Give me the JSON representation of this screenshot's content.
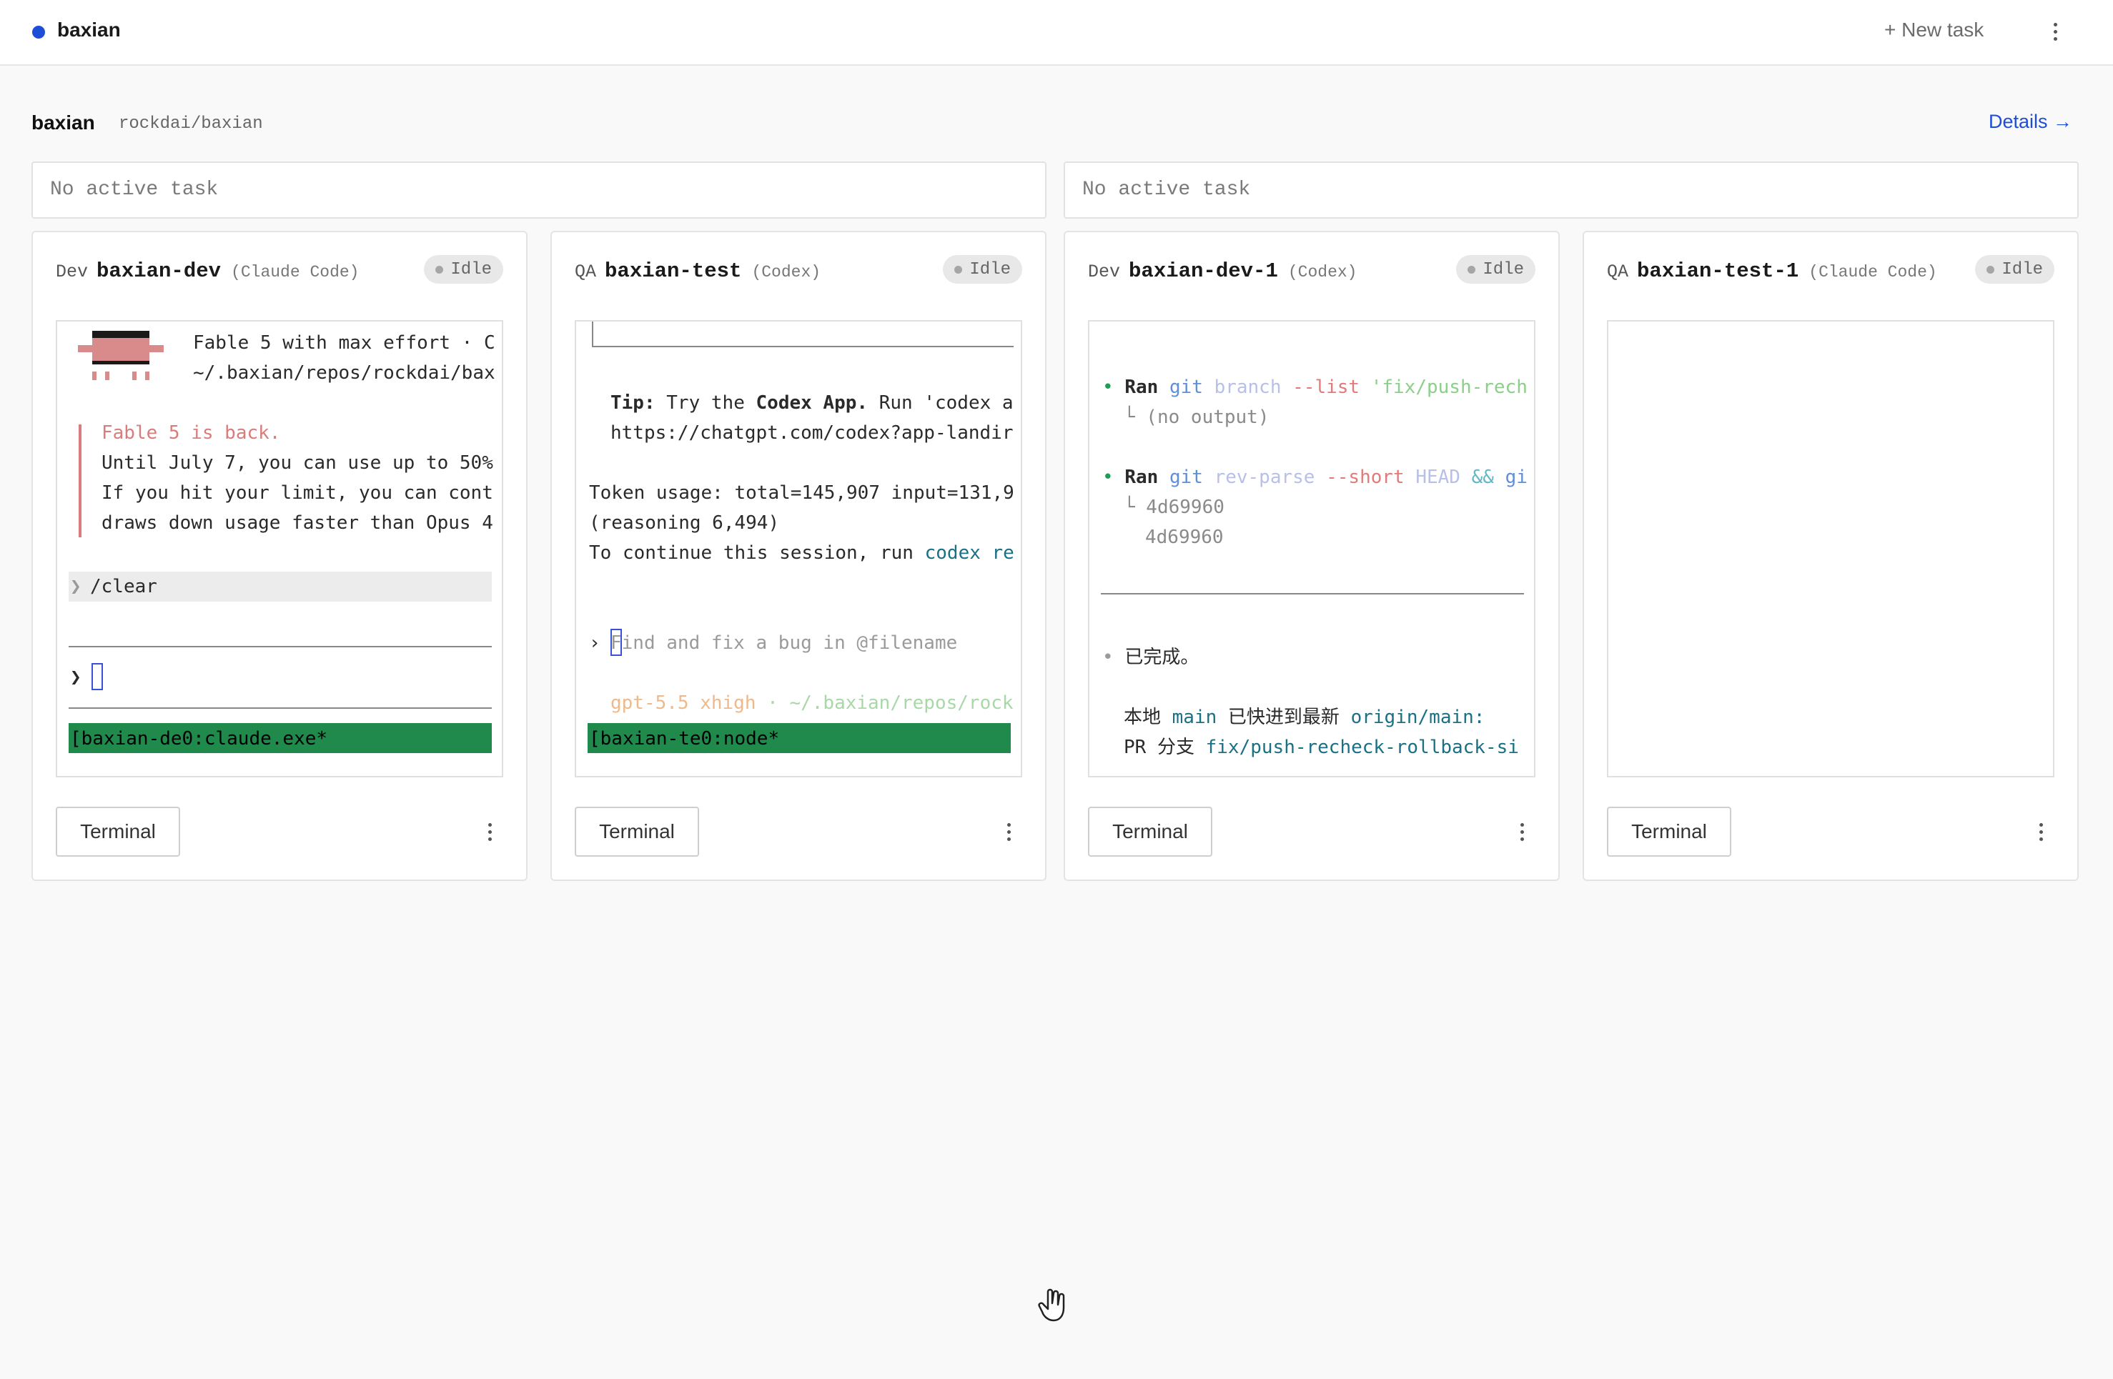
{
  "app": {
    "name": "baxian",
    "new_task_label": "+ New task"
  },
  "project": {
    "name": "baxian",
    "repo": "rockdai/baxian",
    "details_label": "Details →"
  },
  "task_slots": [
    {
      "text": "No active task"
    },
    {
      "text": "No active task"
    }
  ],
  "cards": [
    {
      "role": "Dev",
      "agent": "baxian-dev",
      "tool": "(Claude Code)",
      "status": "Idle",
      "terminal_button": "Terminal",
      "terminal": {
        "header_line1": "Fable 5 with max effort · C",
        "header_line2": "~/.baxian/repos/rockdai/bax",
        "notice": [
          "Fable 5 is back.",
          "Until July 7, you can use up to 50%",
          "If you hit your limit, you can cont",
          "draws down usage faster than Opus 4"
        ],
        "prompt_history": "/clear",
        "prompt_symbol": "❯",
        "tmux_status": "[baxian-de0:claude.exe*"
      }
    },
    {
      "role": "QA",
      "agent": "baxian-test",
      "tool": "(Codex)",
      "status": "Idle",
      "terminal_button": "Terminal",
      "terminal": {
        "tip_label": "Tip:",
        "tip_text_a": " Try the ",
        "tip_bold": "Codex App.",
        "tip_text_b": " Run 'codex a",
        "tip_url": "https://chatgpt.com/codex?app-landir",
        "token_line1": "Token usage: total=145,907 input=131,9",
        "token_line2": "(reasoning 6,494)",
        "continue_text": "To continue this session, run ",
        "continue_cmd": "codex re",
        "input_placeholder": "Find and fix a bug in @filename",
        "model_name": "gpt-5.5 xhigh",
        "model_path": " · ~/.baxian/repos/rock",
        "tmux_status": "[baxian-te0:node*"
      }
    },
    {
      "role": "Dev",
      "agent": "baxian-dev-1",
      "tool": "(Codex)",
      "status": "Idle",
      "terminal_button": "Terminal",
      "terminal": {
        "ran_label": "Ran",
        "cmd1": {
          "git": "git",
          "sub": "branch",
          "flag": "--list",
          "arg": "'fix/push-rech"
        },
        "no_output": "└ (no output)",
        "cmd2": {
          "git": "git",
          "sub": "rev-parse",
          "flag": "--short",
          "arg": "HEAD",
          "op": "&&",
          "tail": "gi"
        },
        "hash1": "└ 4d69960",
        "hash2": "4d69960",
        "done": "已完成。",
        "local_a": "本地 ",
        "local_main": "main",
        "local_b": " 已快进到最新 ",
        "local_origin": "origin/main:",
        "pr_a": "PR 分支 ",
        "pr_branch": "fix/push-recheck-rollback-si"
      }
    },
    {
      "role": "QA",
      "agent": "baxian-test-1",
      "tool": "(Claude Code)",
      "status": "Idle",
      "terminal_button": "Terminal",
      "terminal": {}
    }
  ],
  "colors": {
    "accent": "#1d4ed8",
    "tmux_green": "#1f8a4c",
    "claude_red": "#d97c7c",
    "codex_teal": "#1a7085",
    "bullet_green": "#1f9d55"
  }
}
